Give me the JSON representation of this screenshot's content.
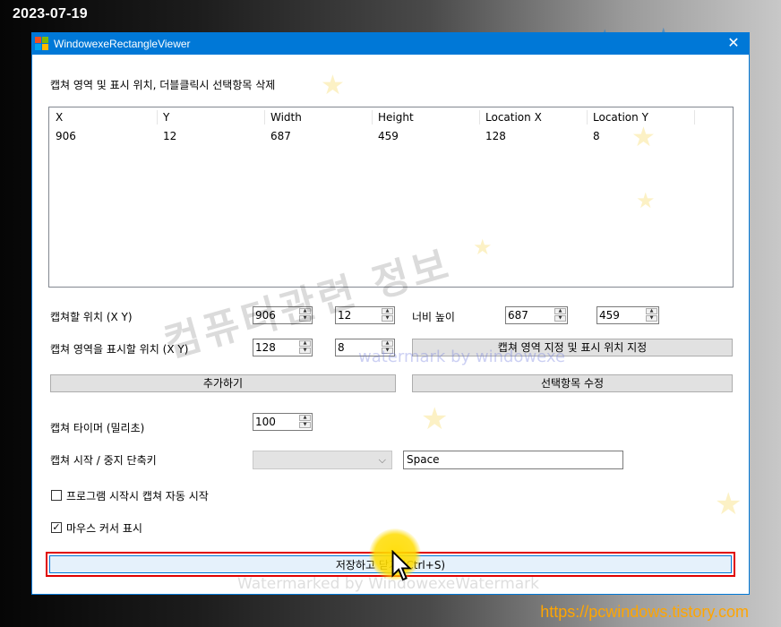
{
  "overlay": {
    "date": "2023-07-19",
    "site_url": "https://pcwindows.tistory.com",
    "watermark_main": "컴퓨터관련 정보",
    "watermark_sub": "watermark by windowexe",
    "watermark_bottom": "Watermarked by WindowexeWatermark"
  },
  "window": {
    "title": "WindowexeRectangleViewer",
    "close_glyph": "✕",
    "accent_color": "#0078d7"
  },
  "list": {
    "caption": "캡쳐 영역 및 표시 위치, 더블클릭시 선택항목 삭제",
    "columns": [
      "X",
      "Y",
      "Width",
      "Height",
      "Location X",
      "Location Y"
    ],
    "rows": [
      [
        "906",
        "12",
        "687",
        "459",
        "128",
        "8"
      ]
    ]
  },
  "capture_pos": {
    "label": "캡쳐할 위치 (X Y)",
    "x": "906",
    "y": "12"
  },
  "size": {
    "label": "너비 높이",
    "width": "687",
    "height": "459"
  },
  "display_pos": {
    "label": "캡쳐 영역을 표시할 위치 (X Y)",
    "x": "128",
    "y": "8"
  },
  "buttons": {
    "set_region": "캡쳐 영역 지정 및 표시 위치 지정",
    "add": "추가하기",
    "edit": "선택항목 수정",
    "save": "저장하고 닫기 (Ctrl+S)"
  },
  "timer": {
    "label": "캡쳐 타이머 (밀리초)",
    "value": "100"
  },
  "hotkey": {
    "label": "캡쳐 시작 / 중지 단축키",
    "combo_value": "",
    "key": "Space"
  },
  "options": {
    "auto_start_label": "프로그램 시작시 캡쳐 자동 시작",
    "auto_start_checked": false,
    "show_cursor_label": "마우스 커서 표시",
    "show_cursor_checked": true
  }
}
